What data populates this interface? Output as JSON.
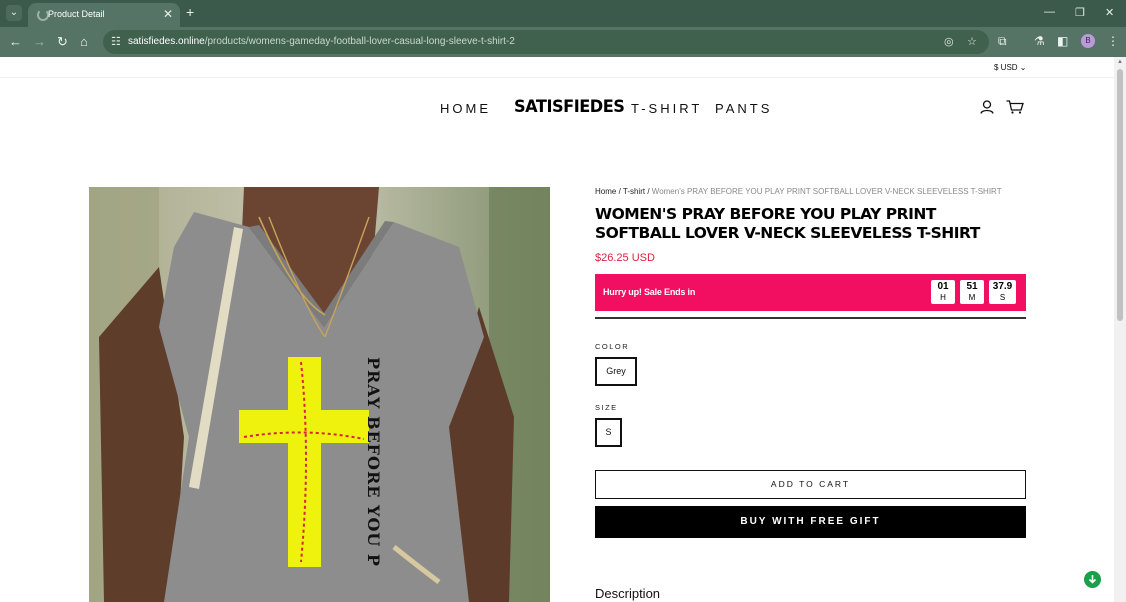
{
  "browser": {
    "tab_title": "Product Detail",
    "url_host": "satisfiedes.online",
    "url_path": "/products/womens-gameday-football-lover-casual-long-sleeve-t-shirt-2",
    "profile_initial": "B"
  },
  "header": {
    "currency": "$ USD",
    "nav_home": "HOME",
    "logo": "SATISFIEDES",
    "nav_tshirt": "T-SHIRT",
    "nav_pants": "PANTS"
  },
  "product": {
    "breadcrumb_home": "Home",
    "breadcrumb_category": "T-shirt",
    "breadcrumb_current": "Women's PRAY BEFORE YOU PLAY PRINT SOFTBALL LOVER V-NECK SLEEVELESS T-SHIRT",
    "title": "WOMEN'S PRAY BEFORE YOU PLAY PRINT SOFTBALL LOVER V-NECK SLEEVELESS T-SHIRT",
    "price": "$26.25 USD",
    "sale_text": "Hurry up! Sale Ends in",
    "countdown": {
      "hours": "01",
      "hours_unit": "H",
      "minutes": "51",
      "minutes_unit": "M",
      "seconds": "37.9",
      "seconds_unit": "S"
    },
    "color_label": "COLOR",
    "color_value": "Grey",
    "size_label": "SIZE",
    "size_value": "S",
    "add_to_cart": "ADD TO CART",
    "buy_button": "BUY WITH FREE GIFT",
    "description_heading": "Description",
    "print_words": [
      "PRAY",
      "BEFORE",
      "YOU PLAY"
    ]
  },
  "colors": {
    "browser_frame": "#3c5a4b",
    "toolbar": "#567466",
    "sale_bar": "#f20e60",
    "price": "#d9233b",
    "shirt": "#8d8d8d",
    "cross": "#eef20d"
  }
}
